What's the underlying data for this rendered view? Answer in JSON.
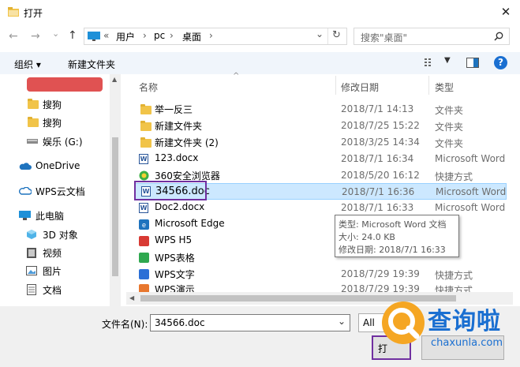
{
  "window": {
    "title": "打开",
    "close_glyph": "✕"
  },
  "nav": {
    "back_glyph": "←",
    "forward_glyph": "→",
    "recent_glyph": "⌄",
    "up_glyph": "↑",
    "breadcrumb_overflow": "«",
    "breadcrumb": [
      "用户",
      "pc",
      "桌面"
    ],
    "breadcrumb_sep": "›",
    "dropdown_glyph": "⌄",
    "refresh_glyph": "↻",
    "search_placeholder": "搜索\"桌面\"",
    "search_icon_glyph": "⚲"
  },
  "toolbar": {
    "organize": "组织 ▾",
    "new_folder": "新建文件夹",
    "help_glyph": "?"
  },
  "sidebar": {
    "items": [
      {
        "label": "搜狗",
        "icon": "folder-icon"
      },
      {
        "label": "搜狗",
        "icon": "folder-icon"
      },
      {
        "label": "娱乐 (G:)",
        "icon": "drive-icon"
      },
      {
        "label": "OneDrive",
        "icon": "cloud-icon"
      },
      {
        "label": "WPS云文档",
        "icon": "cloud-icon"
      },
      {
        "label": "此电脑",
        "icon": "computer-icon"
      },
      {
        "label": "3D 对象",
        "icon": "cube-icon"
      },
      {
        "label": "视频",
        "icon": "video-icon"
      },
      {
        "label": "图片",
        "icon": "picture-icon"
      },
      {
        "label": "文档",
        "icon": "document-icon"
      }
    ]
  },
  "columns": {
    "name": "名称",
    "date": "修改日期",
    "type": "类型",
    "sort_glyph": "^"
  },
  "files": [
    {
      "name": "举一反三",
      "date": "2018/7/1 14:13",
      "type": "文件夹",
      "icon": "folder-icon"
    },
    {
      "name": "新建文件夹",
      "date": "2018/7/25 15:22",
      "type": "文件夹",
      "icon": "folder-icon"
    },
    {
      "name": "新建文件夹 (2)",
      "date": "2018/3/25 14:34",
      "type": "文件夹",
      "icon": "folder-icon"
    },
    {
      "name": "123.docx",
      "date": "2018/7/1 16:34",
      "type": "Microsoft Word",
      "icon": "word-icon"
    },
    {
      "name": "360安全浏览器",
      "date": "2018/5/20 16:12",
      "type": "快捷方式",
      "icon": "browser-icon"
    },
    {
      "name": "34566.doc",
      "date": "2018/7/1 16:36",
      "type": "Microsoft Word",
      "icon": "word-icon"
    },
    {
      "name": "Doc2.docx",
      "date": "2018/7/1 16:33",
      "type": "Microsoft Word",
      "icon": "word-icon"
    },
    {
      "name": "Microsoft Edge",
      "date": "",
      "type": "",
      "icon": "edge-icon"
    },
    {
      "name": "WPS H5",
      "date": "",
      "type": "",
      "icon": "wps-icon"
    },
    {
      "name": "WPS表格",
      "date": "",
      "type": "",
      "icon": "wps-sheet-icon"
    },
    {
      "name": "WPS文字",
      "date": "2018/7/29 19:39",
      "type": "快捷方式",
      "icon": "wps-writer-icon"
    },
    {
      "name": "WPS演示",
      "date": "2018/7/29 19:39",
      "type": "快捷方式",
      "icon": "wps-present-icon"
    }
  ],
  "tooltip": {
    "type_line": "类型: Microsoft Word 文档",
    "size_line": "大小: 24.0 KB",
    "date_line": "修改日期: 2018/7/1 16:33"
  },
  "footer": {
    "filename_label": "文件名(N):",
    "filename_value": "34566.doc",
    "filter_value": "All",
    "open_button": "打"
  },
  "watermark": {
    "text": "查询啦",
    "url": "chaxunla.com"
  },
  "colors": {
    "selection": "#cce8ff",
    "highlight_box": "#7030a0",
    "watermark_orange": "#f5a623",
    "watermark_blue": "#1a6fd1"
  }
}
